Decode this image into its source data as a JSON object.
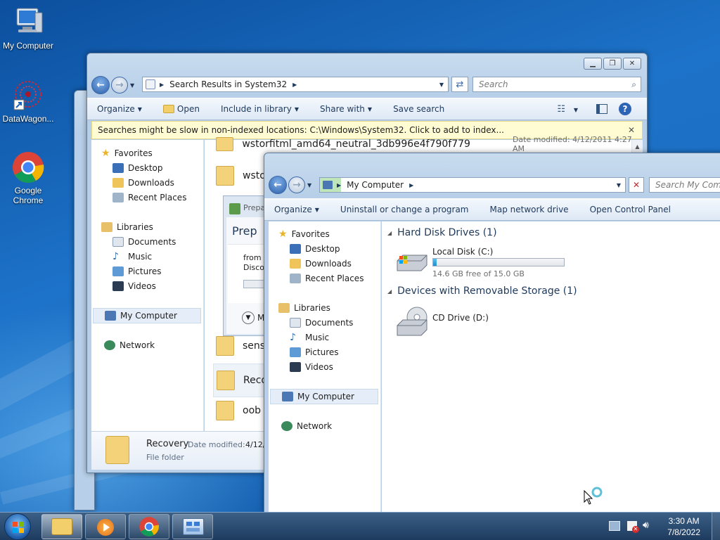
{
  "desktop": {
    "icons": [
      {
        "label": "My Computer",
        "icon": "computer-icon"
      },
      {
        "label": "DataWagon...",
        "icon": "datawagon-icon"
      },
      {
        "label": "Google Chrome",
        "icon": "chrome-icon"
      }
    ]
  },
  "search_window": {
    "address_path": "Search Results in System32",
    "search_placeholder": "Search",
    "toolbar": {
      "organize": "Organize",
      "open": "Open",
      "include_in_library": "Include in library",
      "share_with": "Share with",
      "save_search": "Save search"
    },
    "infobar": "Searches might be slow in non-indexed locations: C:\\Windows\\System32. Click to add to index...",
    "infobar_close": "✕",
    "nav": {
      "favorites": "Favorites",
      "desktop": "Desktop",
      "downloads": "Downloads",
      "recent_places": "Recent Places",
      "libraries": "Libraries",
      "documents": "Documents",
      "music": "Music",
      "pictures": "Pictures",
      "videos": "Videos",
      "my_computer": "My Computer",
      "network": "Network"
    },
    "results": [
      {
        "name": "wstorfitml_amd64_neutral_3db996e4f790f779"
      },
      {
        "name": "wsto"
      },
      {
        "name": "sens"
      },
      {
        "name": "Reco"
      },
      {
        "name": "oob"
      }
    ],
    "first_row_modified": "Date modified: 4/12/2011 4:27 AM",
    "details": {
      "name": "Recovery",
      "modified_label": "Date modified:",
      "modified_value": "4/12/",
      "type": "File folder"
    },
    "dialog": {
      "title": "Prepa",
      "heading": "Prep",
      "line1": "from",
      "line2": "Disco",
      "more": "M"
    }
  },
  "computer_window": {
    "address_path": "My Computer",
    "search_placeholder": "Search My Compu",
    "toolbar": {
      "organize": "Organize",
      "uninstall": "Uninstall or change a program",
      "map_drive": "Map network drive",
      "control_panel": "Open Control Panel"
    },
    "nav": {
      "favorites": "Favorites",
      "desktop": "Desktop",
      "downloads": "Downloads",
      "recent_places": "Recent Places",
      "libraries": "Libraries",
      "documents": "Documents",
      "music": "Music",
      "pictures": "Pictures",
      "videos": "Videos",
      "my_computer": "My Computer",
      "network": "Network"
    },
    "groups": {
      "hard_disks": "Hard Disk Drives (1)",
      "removable": "Devices with Removable Storage (1)"
    },
    "local_disk": {
      "name": "Local Disk (C:)",
      "free": "14.6 GB free of 15.0 GB",
      "used_fraction": 0.027
    },
    "cd_drive": {
      "name": "CD Drive (D:)"
    }
  },
  "taskbar": {
    "time": "3:30 AM",
    "date": "7/8/2022"
  },
  "colors": {
    "accent": "#1e395b",
    "infobar": "#fffbd3",
    "selection": "#e5eef8",
    "disk_bar": "#26a0da"
  }
}
